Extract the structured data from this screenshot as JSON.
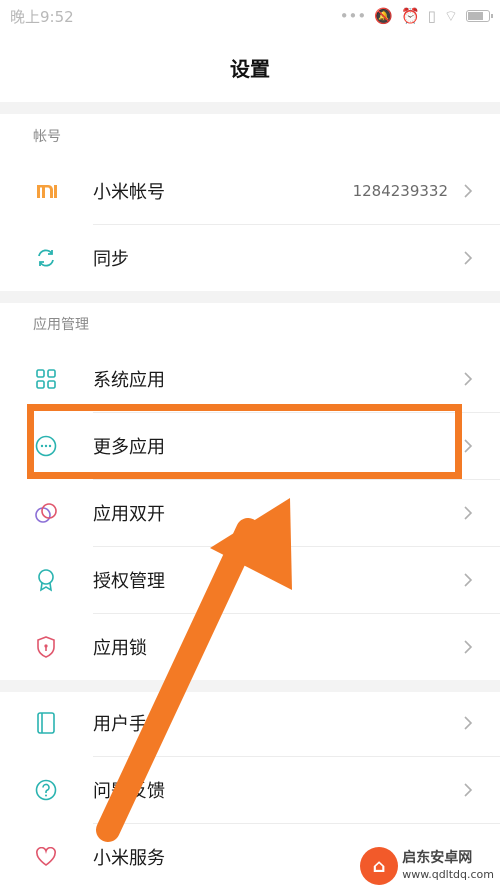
{
  "status": {
    "time": "晚上9:52",
    "icons": [
      "signal-dots-icon",
      "mute-icon",
      "alarm-icon",
      "vibrate-icon",
      "wifi-icon",
      "battery-icon"
    ]
  },
  "header": {
    "title": "设置"
  },
  "sections": {
    "account": {
      "label": "帐号",
      "items": [
        {
          "label": "小米帐号",
          "value": "1284239332",
          "icon": "mi-logo-icon"
        },
        {
          "label": "同步",
          "icon": "sync-icon"
        }
      ]
    },
    "apps": {
      "label": "应用管理",
      "items": [
        {
          "label": "系统应用",
          "icon": "grid-icon"
        },
        {
          "label": "更多应用",
          "icon": "more-dots-icon"
        },
        {
          "label": "应用双开",
          "icon": "dual-app-icon"
        },
        {
          "label": "授权管理",
          "icon": "badge-icon"
        },
        {
          "label": "应用锁",
          "icon": "shield-lock-icon"
        }
      ]
    },
    "help": {
      "items": [
        {
          "label": "用户手册",
          "icon": "manual-icon"
        },
        {
          "label": "问题反馈",
          "icon": "question-icon"
        },
        {
          "label": "小米服务",
          "icon": "heart-icon"
        }
      ]
    }
  },
  "watermark": {
    "title": "启东安卓网",
    "url": "www.qdltdq.com"
  },
  "colors": {
    "accent": "#f37a25",
    "teal": "#2ab3b0",
    "mi_orange": "#f7a03c",
    "pink": "#e0566c"
  }
}
